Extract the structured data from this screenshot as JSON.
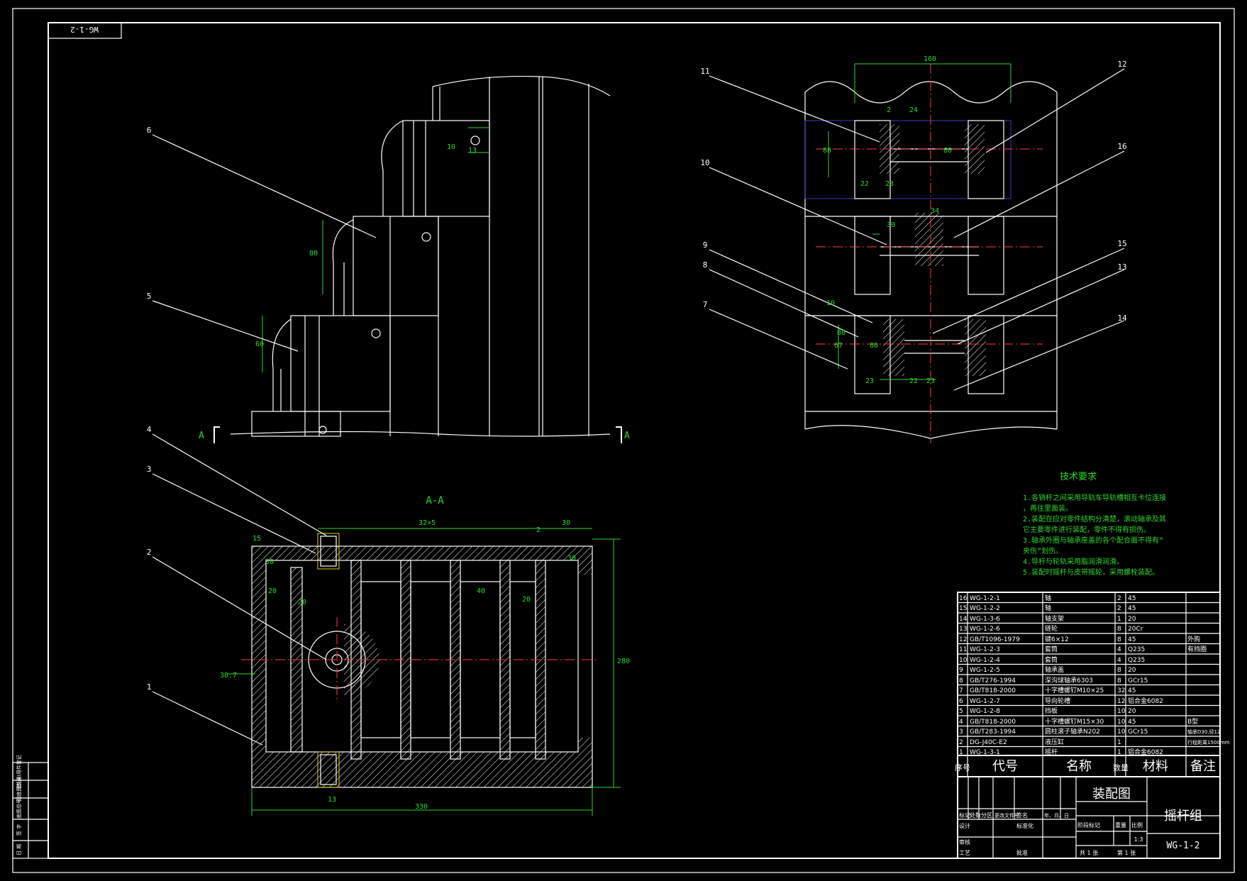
{
  "drawing": {
    "code": "WG-1-2",
    "code_rotated": "WG-1-2",
    "title_main": "装配图",
    "title_part": "摇杆组",
    "scale": "1:3",
    "sheet_total": "共 1 张",
    "sheet_no": "第 1 张"
  },
  "section": {
    "label": "A-A",
    "marker_left": "A",
    "marker_right": "A"
  },
  "tech_requirements": {
    "title": "技术要求",
    "items": [
      "1.各销杆之间采用导轨车导轨槽相互卡位连接",
      "  ，再往里面装。",
      "2.装配在应对零件结构分清楚，滚动轴承及其",
      "  它主要零件进行装配，零件不得有损伤。",
      "3.轴承外圈与轴承座盖的各个配合面不得有“",
      "  夹伤”划伤。",
      "4.导杆与轮轨采用脂润滑润滑。",
      "5.装配时摇杆与皮带摇轮，采用螺栓装配。"
    ]
  },
  "callouts": [
    "1",
    "2",
    "3",
    "4",
    "5",
    "6",
    "7",
    "8",
    "9",
    "10",
    "11",
    "12",
    "13",
    "14",
    "15",
    "16"
  ],
  "dimensions": [
    "32×5",
    "30",
    "2",
    "15",
    "30",
    "30",
    "20",
    "20",
    "40",
    "20",
    "38.7",
    "330",
    "280",
    "13",
    "10",
    "160",
    "24",
    "80",
    "80",
    "2",
    "23",
    "22",
    "23",
    "80",
    "30",
    "34",
    "10",
    "80",
    "67",
    "23",
    "22",
    "80",
    "13",
    "60"
  ],
  "bom": {
    "headers": {
      "no": "序号",
      "code": "代号",
      "name": "名称",
      "qty": "数量",
      "material": "材料",
      "note": "备注"
    },
    "rows": [
      {
        "no": "16",
        "code": "WG-1-2-1",
        "name": "轴",
        "qty": "2",
        "material": "45",
        "note": ""
      },
      {
        "no": "15",
        "code": "WG-1-2-2",
        "name": "轴",
        "qty": "2",
        "material": "45",
        "note": ""
      },
      {
        "no": "14",
        "code": "WG-1-3-6",
        "name": "轴支架",
        "qty": "1",
        "material": "20",
        "note": ""
      },
      {
        "no": "13",
        "code": "WG-1-2-6",
        "name": "链轮",
        "qty": "8",
        "material": "20Cr",
        "note": ""
      },
      {
        "no": "12",
        "code": "GB/T1096-1979",
        "name": "键6×12",
        "qty": "8",
        "material": "45",
        "note": "外购"
      },
      {
        "no": "11",
        "code": "WG-1-2-3",
        "name": "套筒",
        "qty": "4",
        "material": "Q235",
        "note": "有挡圈"
      },
      {
        "no": "10",
        "code": "WG-1-2-4",
        "name": "套筒",
        "qty": "4",
        "material": "Q235",
        "note": ""
      },
      {
        "no": "9",
        "code": "WG-1-2-5",
        "name": "轴承盖",
        "qty": "8",
        "material": "20",
        "note": ""
      },
      {
        "no": "8",
        "code": "GB/T276-1994",
        "name": "深沟球轴承6303",
        "qty": "8",
        "material": "GCr15",
        "note": ""
      },
      {
        "no": "7",
        "code": "GB/T818-2000",
        "name": "十字槽螺钉M10×25",
        "qty": "32",
        "material": "45",
        "note": ""
      },
      {
        "no": "6",
        "code": "WG-1-2-7",
        "name": "导向轮槽",
        "qty": "12",
        "material": "铝合金6082",
        "note": ""
      },
      {
        "no": "5",
        "code": "WG-1-2-8",
        "name": "挡板",
        "qty": "10",
        "material": "20",
        "note": ""
      },
      {
        "no": "4",
        "code": "GB/T818-2000",
        "name": "十字槽螺钉M15×30",
        "qty": "10",
        "material": "45",
        "note": "B型"
      },
      {
        "no": "3",
        "code": "GB/T283-1994",
        "name": "圆柱滚子轴承N202",
        "qty": "10",
        "material": "GCr15",
        "note": "轴承D30,径12"
      },
      {
        "no": "2",
        "code": "DG-J40C-E2",
        "name": "液压缸",
        "qty": "1",
        "material": "",
        "note": "行程距离1500mm"
      },
      {
        "no": "1",
        "code": "WG-1-3-1",
        "name": "摇杆",
        "qty": "1",
        "material": "铝合金6082",
        "note": ""
      }
    ]
  },
  "title_block": {
    "labels": [
      "标记",
      "处数",
      "分区",
      "更改文件号",
      "签名",
      "年、月、日",
      "设计",
      "标准化",
      "阶段标记",
      "重量",
      "比例",
      "审核",
      "工艺",
      "批准",
      "共",
      "张",
      "第",
      "张"
    ]
  },
  "left_strip": {
    "labels": [
      "借(通)用件登记",
      "旧底图总号",
      "底图总号",
      "签 字",
      "日 期"
    ]
  }
}
